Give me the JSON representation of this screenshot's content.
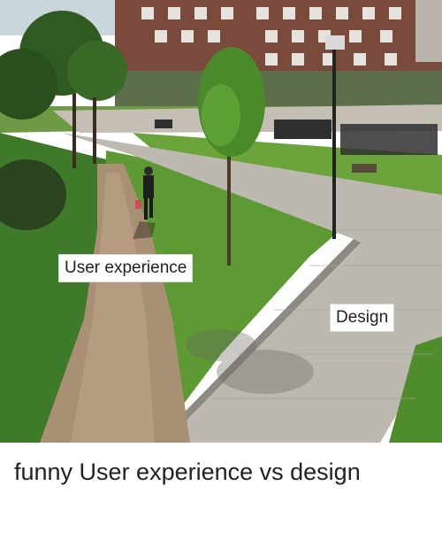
{
  "photo": {
    "labels": {
      "user_experience": "User experience",
      "design": "Design"
    }
  },
  "caption": {
    "text": "funny User experience vs design"
  }
}
